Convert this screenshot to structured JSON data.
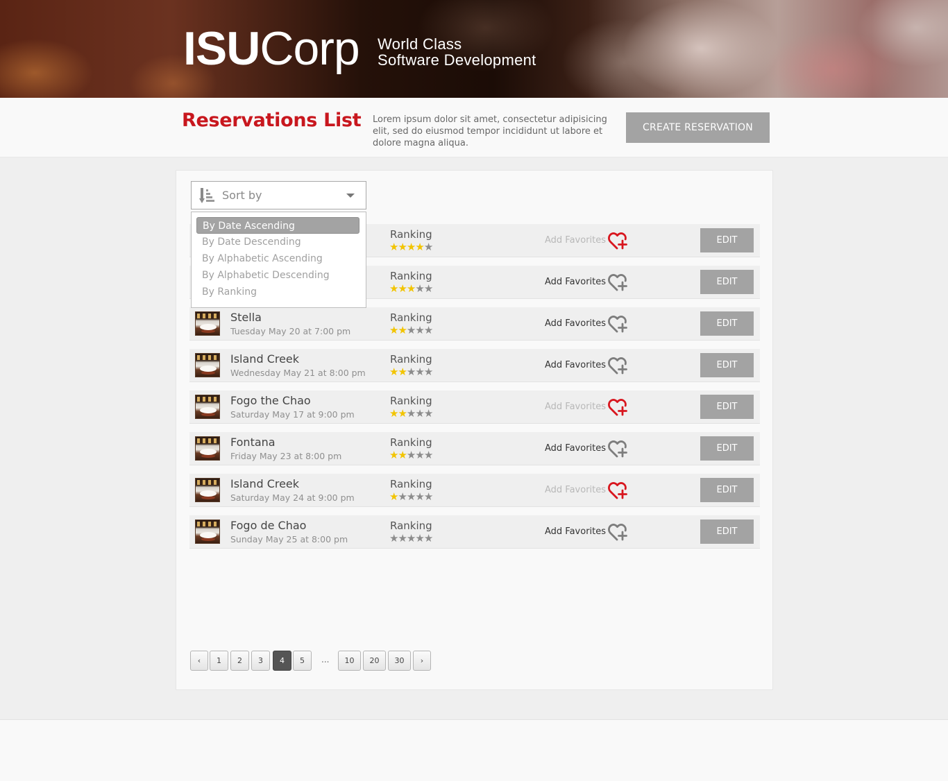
{
  "header": {
    "logo_bold": "ISU",
    "logo_light": "Corp",
    "tagline_line1": "World Class",
    "tagline_line2": "Software Development"
  },
  "titlebar": {
    "title": "Reservations List",
    "description": "Lorem ipsum dolor sit amet, consectetur adipisicing elit, sed do eiusmod tempor incididunt ut labore et dolore magna aliqua.",
    "create_button": "CREATE RESERVATION"
  },
  "sort": {
    "label": "Sort by",
    "options": [
      "By Date Ascending",
      "By Date Descending",
      "By Alphabetic Ascending",
      "By Alphabetic Descending",
      "By Ranking"
    ],
    "selected_index": 0
  },
  "reservations": {
    "ranking_label": "Ranking",
    "favorites_label": "Add Favorites",
    "edit_label": "EDIT",
    "items": [
      {
        "name": "",
        "date": "",
        "stars": 4,
        "favorited": true
      },
      {
        "name": "",
        "date": "",
        "stars": 3,
        "favorited": false
      },
      {
        "name": "Stella",
        "date": "Tuesday May 20 at 7:00 pm",
        "stars": 2,
        "favorited": false
      },
      {
        "name": "Island Creek",
        "date": "Wednesday May 21 at 8:00 pm",
        "stars": 2,
        "favorited": false
      },
      {
        "name": "Fogo the Chao",
        "date": "Saturday May 17 at 9:00 pm",
        "stars": 2,
        "favorited": true
      },
      {
        "name": "Fontana",
        "date": "Friday May 23 at 8:00 pm",
        "stars": 2,
        "favorited": false
      },
      {
        "name": "Island Creek",
        "date": "Saturday May 24 at 9:00 pm",
        "stars": 1,
        "favorited": true
      },
      {
        "name": "Fogo de Chao",
        "date": "Sunday May 25 at 8:00 pm",
        "stars": 0,
        "favorited": false
      }
    ]
  },
  "pagination": {
    "prev": "‹",
    "next": "›",
    "pages": [
      "1",
      "2",
      "3",
      "4",
      "5"
    ],
    "ellipsis": "...",
    "jump_pages": [
      "10",
      "20",
      "30"
    ],
    "current": "4"
  },
  "colors": {
    "accent_red": "#c8171e",
    "button_grey": "#a3a3a3",
    "star_on": "#f2c400",
    "star_off": "#8c8c8c"
  },
  "icons": {
    "sort": "sort-descending-icon",
    "dropdown": "chevron-down-icon",
    "favorite": "heart-plus-icon",
    "thumbnail": "restaurant-thumbnail"
  }
}
